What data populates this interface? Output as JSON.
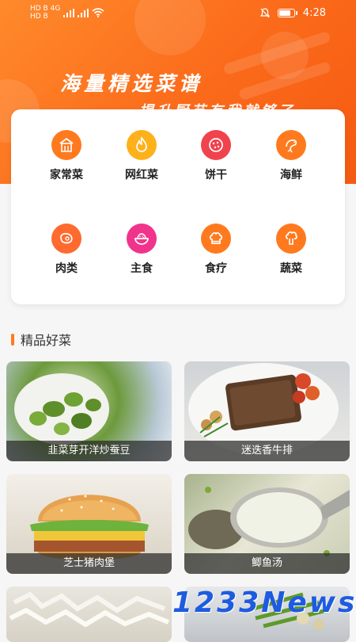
{
  "status": {
    "left_top": "HD B 4G",
    "left_bottom": "HD B",
    "time": "4:28",
    "battery_level": 0.85
  },
  "banner": {
    "title": "海量精选菜谱",
    "subtitle": "提升厨艺有我就够了"
  },
  "categories": [
    {
      "label": "家常菜",
      "icon": "house-icon",
      "color": "#ff7a1e"
    },
    {
      "label": "网红菜",
      "icon": "flame-icon",
      "color": "#ffb11b"
    },
    {
      "label": "饼干",
      "icon": "cookie-icon",
      "color": "#f0434e"
    },
    {
      "label": "海鲜",
      "icon": "shrimp-icon",
      "color": "#ff7a1e"
    },
    {
      "label": "肉类",
      "icon": "meat-icon",
      "color": "#ff6a2e"
    },
    {
      "label": "主食",
      "icon": "rice-bowl-icon",
      "color": "#f0348b"
    },
    {
      "label": "食疗",
      "icon": "chef-hat-icon",
      "color": "#ff7a1e"
    },
    {
      "label": "蔬菜",
      "icon": "broccoli-icon",
      "color": "#ff7a1e"
    }
  ],
  "section": {
    "title": "精品好菜"
  },
  "dishes": [
    {
      "name": "韭菜芽开洋炒蚕豆"
    },
    {
      "name": "迷迭香牛排"
    },
    {
      "name": "芝士猪肉堡"
    },
    {
      "name": "鲫鱼汤"
    },
    {
      "name": ""
    },
    {
      "name": ""
    }
  ],
  "watermark": "1233News"
}
